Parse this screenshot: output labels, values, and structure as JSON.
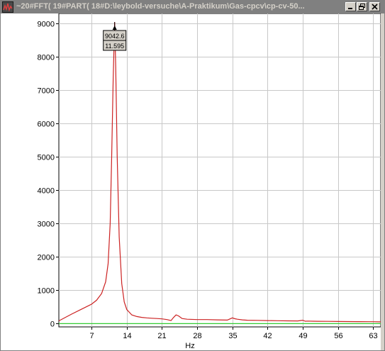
{
  "window": {
    "title": "~20#FFT( 19#PART( 18#D:\\leybold-versuche\\A-Praktikum\\Gas-cpcv\\cp-cv-50...",
    "buttons": {
      "minimize": "minimize-icon",
      "restore": "restore-icon",
      "close": "close-icon"
    }
  },
  "colors": {
    "titlebar": "#808080",
    "title_text": "#d4d0c8",
    "spectrum": "#cc2222",
    "baseline": "#22cc22",
    "grid": "#c8c8c8"
  },
  "chart_data": {
    "type": "line",
    "xlabel": "Hz",
    "ylabel": "",
    "xlim": [
      0.5,
      64.5
    ],
    "ylim": [
      -100,
      9300
    ],
    "xticks": [
      7,
      14,
      21,
      28,
      35,
      42,
      49,
      56,
      63
    ],
    "xtick_labels": [
      "7",
      "14",
      "21",
      "28",
      "35",
      "42",
      "49",
      "56",
      "63"
    ],
    "yticks": [
      0,
      1000,
      2000,
      3000,
      4000,
      5000,
      6000,
      7000,
      8000,
      9000
    ],
    "ytick_labels": [
      "0",
      "1000",
      "2000",
      "3000",
      "4000",
      "5000",
      "6000",
      "7000",
      "8000",
      "9000"
    ],
    "grid": true,
    "series": [
      {
        "color": "#cc2222",
        "x": [
          0.5,
          3,
          5,
          7,
          8,
          9,
          9.8,
          10.3,
          10.7,
          11,
          11.3,
          11.595,
          11.8,
          12.1,
          12.5,
          13,
          13.5,
          14,
          15,
          16,
          17,
          18,
          19,
          20,
          21,
          22,
          22.8,
          23.3,
          23.8,
          24.3,
          25,
          26,
          28,
          30,
          32,
          34,
          35,
          35.5,
          36,
          37,
          38,
          40,
          42,
          44,
          46,
          48,
          49,
          49.5,
          50,
          51,
          52,
          54,
          56,
          58,
          60,
          62,
          63,
          64,
          64.5
        ],
        "y": [
          80,
          280,
          430,
          580,
          700,
          900,
          1250,
          1800,
          3000,
          5000,
          7300,
          9042.6,
          7700,
          5000,
          2600,
          1200,
          650,
          420,
          260,
          210,
          185,
          170,
          160,
          150,
          140,
          120,
          90,
          180,
          260,
          230,
          150,
          130,
          120,
          120,
          110,
          105,
          170,
          145,
          130,
          110,
          100,
          95,
          90,
          85,
          80,
          78,
          100,
          70,
          75,
          70,
          68,
          65,
          62,
          60,
          58,
          56,
          55,
          50,
          50
        ]
      },
      {
        "color": "#22cc22",
        "x": [
          0.5,
          64.5
        ],
        "y": [
          0,
          0
        ]
      }
    ],
    "annotations": [
      {
        "label_top": "9042.6",
        "label_bottom": "11.595",
        "x": 11.595,
        "y": 9042.6
      }
    ]
  }
}
